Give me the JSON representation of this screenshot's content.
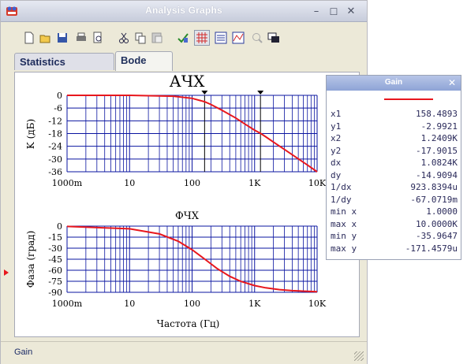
{
  "window": {
    "title": "Analysis Graphs"
  },
  "tabs": [
    {
      "label": "Statistics [Analog]"
    },
    {
      "label": "Bode"
    }
  ],
  "toolbar": {
    "icons": [
      "new-icon",
      "open-icon",
      "save-icon",
      "print-icon",
      "print-preview-icon",
      "cut-icon",
      "copy-icon",
      "paste-icon",
      "properties-icon",
      "grid-icon",
      "table-icon",
      "chart-icon",
      "zoom-icon",
      "window-icon"
    ]
  },
  "status": {
    "text": "Gain"
  },
  "colors": {
    "trace": "#e8171d",
    "grid": "#0a14a0",
    "accent": "#9fb2e0"
  },
  "gain_panel": {
    "title": "Gain",
    "rows": [
      {
        "k": "x1",
        "v": "158.4893"
      },
      {
        "k": "y1",
        "v": "-2.9921"
      },
      {
        "k": "x2",
        "v": "1.2409K"
      },
      {
        "k": "y2",
        "v": "-17.9015"
      },
      {
        "k": "dx",
        "v": "1.0824K"
      },
      {
        "k": "dy",
        "v": "-14.9094"
      },
      {
        "k": "1/dx",
        "v": "923.8394u"
      },
      {
        "k": "1/dy",
        "v": "-67.0719m"
      },
      {
        "k": "min x",
        "v": "1.0000"
      },
      {
        "k": "max x",
        "v": "10.0000K"
      },
      {
        "k": "min y",
        "v": "-35.9647"
      },
      {
        "k": "max y",
        "v": "-171.4579u"
      }
    ]
  },
  "chart_data": [
    {
      "type": "line",
      "title": "АЧХ",
      "xlabel": "",
      "ylabel": "K (дБ)",
      "xscale": "log",
      "xlim": [
        1,
        10000
      ],
      "ylim": [
        -36,
        0
      ],
      "x_ticks": [
        "1000m",
        "10",
        "100",
        "1K",
        "10K"
      ],
      "y_ticks": [
        "0",
        "-6",
        "-12",
        "-18",
        "-24",
        "-30",
        "-36"
      ],
      "cursors_x": [
        158.4893,
        1240.9
      ],
      "series": [
        {
          "x": [
            1,
            10,
            50,
            100,
            158.5,
            200,
            300,
            500,
            700,
            1000,
            1241,
            1500,
            2000,
            3000,
            5000,
            7000,
            10000
          ],
          "y": [
            0,
            0,
            -0.4,
            -1.4,
            -3.0,
            -4.3,
            -7.0,
            -10.7,
            -13.5,
            -16.4,
            -17.9,
            -19.5,
            -22.0,
            -25.5,
            -29.9,
            -32.8,
            -36.0
          ]
        }
      ]
    },
    {
      "type": "line",
      "title": "ФЧХ",
      "xlabel": "Частота (Гц)",
      "ylabel": "Фаза (град)",
      "xscale": "log",
      "xlim": [
        1,
        10000
      ],
      "ylim": [
        -90,
        0
      ],
      "x_ticks": [
        "1000m",
        "10",
        "100",
        "1K",
        "10K"
      ],
      "y_ticks": [
        "0",
        "-15",
        "-30",
        "-45",
        "-60",
        "-75",
        "-90"
      ],
      "series": [
        {
          "x": [
            1,
            10,
            30,
            60,
            100,
            160,
            250,
            400,
            600,
            1000,
            1500,
            2500,
            4000,
            10000
          ],
          "y": [
            -0.4,
            -3.6,
            -10.6,
            -20.6,
            -32.1,
            -45.0,
            -57.5,
            -68.3,
            -75.1,
            -80.9,
            -83.9,
            -86.4,
            -87.7,
            -89.1
          ]
        }
      ]
    }
  ]
}
